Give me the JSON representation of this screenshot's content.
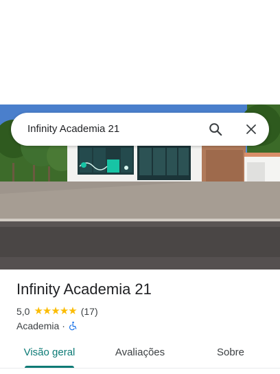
{
  "search": {
    "query": "Infinity Academia 21"
  },
  "place": {
    "name": "Infinity Academia 21",
    "rating": "5,0",
    "stars": 5,
    "review_count": "(17)",
    "category": "Academia",
    "separator": "·"
  },
  "tabs": [
    {
      "label": "Visão geral",
      "active": true
    },
    {
      "label": "Avaliações",
      "active": false
    },
    {
      "label": "Sobre",
      "active": false
    }
  ],
  "icons": {
    "search": "search-icon",
    "close": "close-icon",
    "star": "star-icon",
    "accessibility": "wheelchair-icon"
  },
  "colors": {
    "accent": "#0b7a75",
    "star": "#fbbc04",
    "wheelchair": "#1a73e8"
  }
}
